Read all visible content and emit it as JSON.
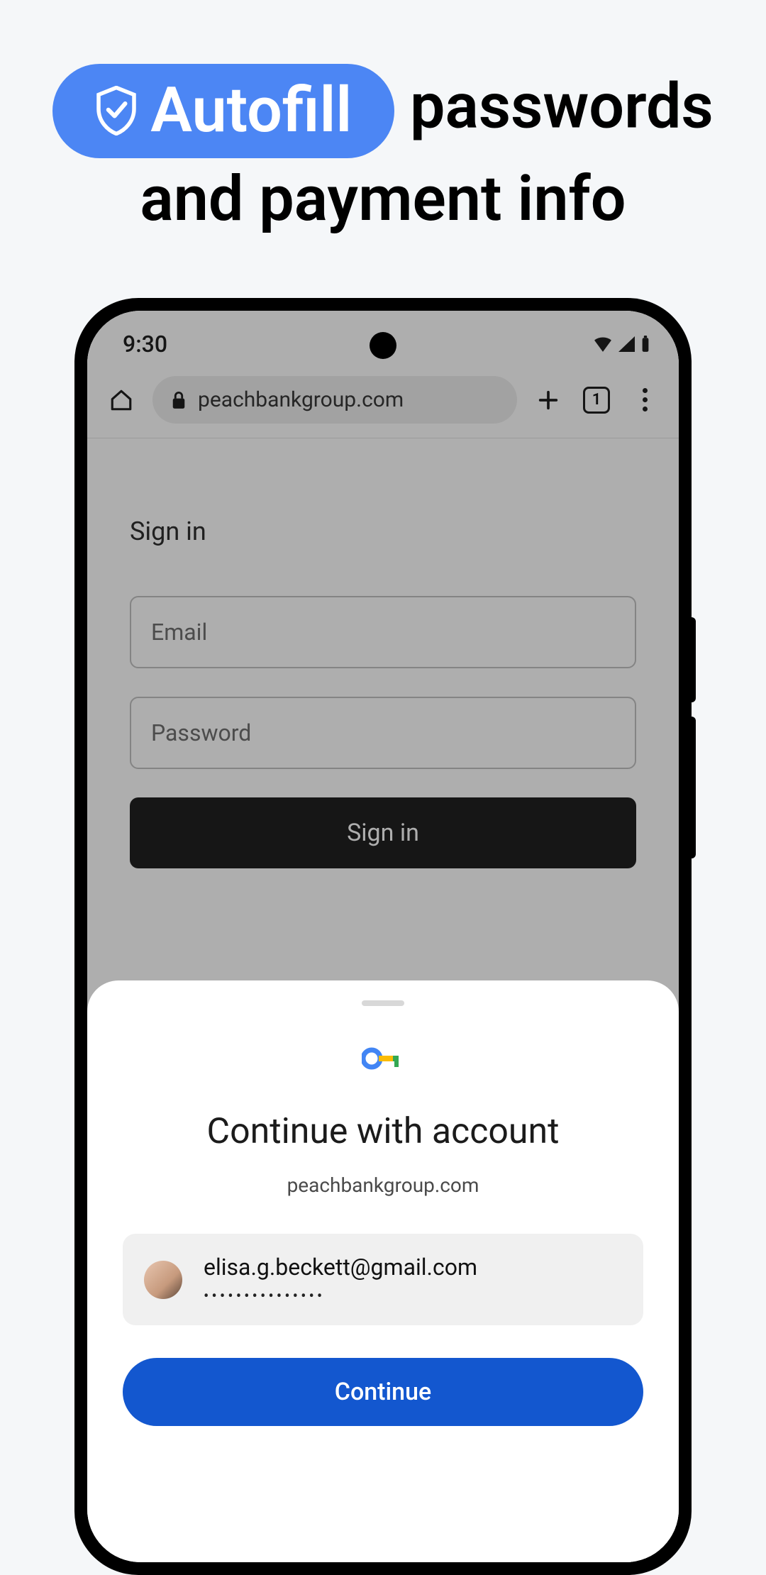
{
  "hero": {
    "pill_label": "Autofill",
    "line1_rest": " passwords",
    "line2": "and payment info"
  },
  "status": {
    "time": "9:30"
  },
  "browser": {
    "url": "peachbankgroup.com",
    "tab_count": "1"
  },
  "page": {
    "heading": "Sign in",
    "email_placeholder": "Email",
    "password_placeholder": "Password",
    "submit_label": "Sign in"
  },
  "sheet": {
    "title": "Continue with account",
    "domain": "peachbankgroup.com",
    "account_email": "elisa.g.beckett@gmail.com",
    "account_password_mask": "•••••••••••••••",
    "continue_label": "Continue"
  }
}
